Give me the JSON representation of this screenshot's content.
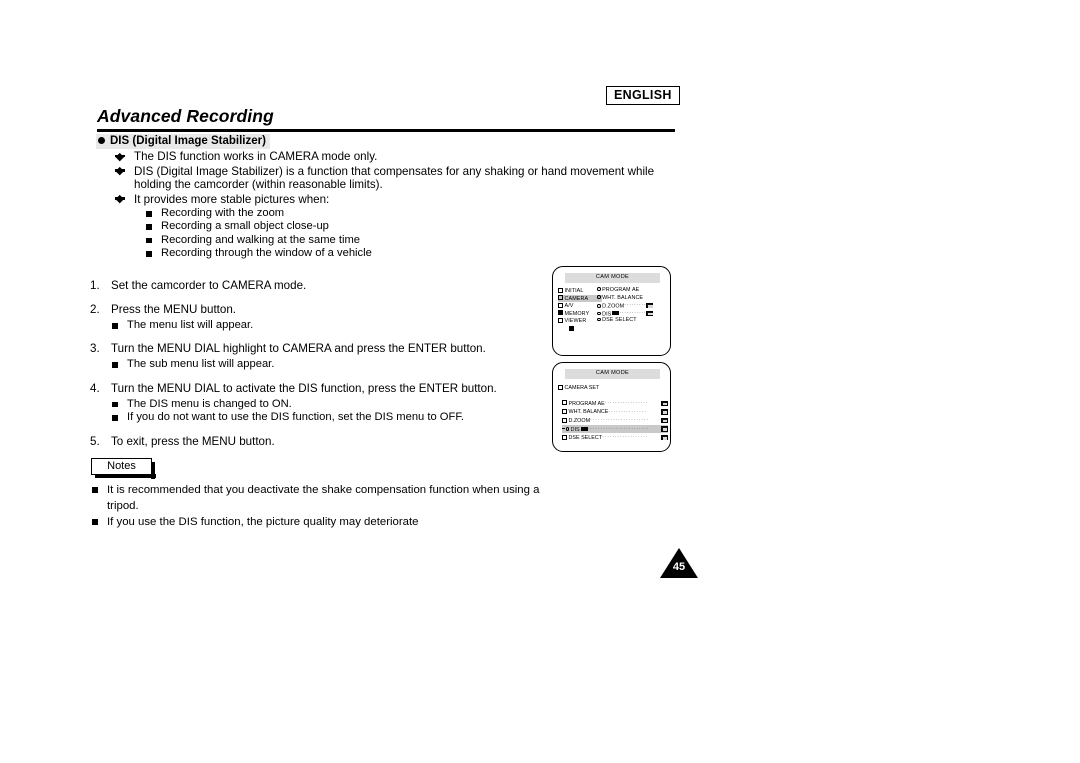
{
  "header": {
    "language_badge": "ENGLISH",
    "chapter_title": "Advanced Recording"
  },
  "section": {
    "heading": "DIS (Digital Image Stabilizer)",
    "bullets": [
      {
        "text": "The DIS function works in CAMERA mode only."
      },
      {
        "text": "DIS (Digital Image Stabilizer) is a function that compensates for any shaking or hand movement while holding the camcorder (within reasonable limits)."
      },
      {
        "text": "It provides more stable pictures when:",
        "sub": [
          "Recording with the zoom",
          "Recording a small object close-up",
          "Recording and walking at the same time",
          "Recording through the window of a vehicle"
        ]
      }
    ]
  },
  "steps": [
    {
      "num": "1.",
      "text": "Set the camcorder to CAMERA mode.",
      "sub": []
    },
    {
      "num": "2.",
      "text": "Press the MENU button.",
      "sub": [
        "The menu list will appear."
      ]
    },
    {
      "num": "3.",
      "text": "Turn the MENU DIAL highlight to CAMERA and press the ENTER button.",
      "sub": [
        "The sub menu list will appear."
      ]
    },
    {
      "num": "4.",
      "text": "Turn the MENU DIAL to activate the DIS function, press the ENTER button.",
      "sub": [
        "The DIS menu is changed to ON.",
        "If you do not want to use the DIS function, set the DIS menu to OFF."
      ]
    },
    {
      "num": "5.",
      "text": "To exit, press the MENU button.",
      "sub": []
    }
  ],
  "notes": {
    "label": "Notes",
    "items": [
      "It is recommended that you deactivate the shake compensation function when using a tripod.",
      "If you use the DIS function, the picture quality may deteriorate"
    ]
  },
  "lcd_screens": [
    {
      "id": "main-menu",
      "title": "CAM MODE",
      "left_column": [
        {
          "label": "INITIAL",
          "icon": "folder-icon",
          "highlighted": false
        },
        {
          "label": "CAMERA",
          "icon": "folder-icon",
          "highlighted": true
        },
        {
          "label": "A/V",
          "icon": "folder-icon",
          "highlighted": false
        },
        {
          "label": "MEMORY",
          "icon": "folder-filled-icon",
          "highlighted": false
        },
        {
          "label": "VIEWER",
          "icon": "folder-icon",
          "highlighted": false
        },
        {
          "label": "",
          "icon": "exit-icon",
          "highlighted": false
        }
      ],
      "right_column": [
        {
          "label": "PROGRAM AE",
          "icon": "bullet-icon",
          "dots": false,
          "badge": false
        },
        {
          "label": "WHT. BALANCE",
          "icon": "bullet-icon",
          "dots": false,
          "badge": false
        },
        {
          "label": "D.ZOOM",
          "icon": "bullet-icon",
          "dots": true,
          "badge": true
        },
        {
          "label": "DIS",
          "icon": "bullet-icon",
          "dots": true,
          "badge": true
        },
        {
          "label": "DSE SELECT",
          "icon": "bullet-icon",
          "dots": false,
          "badge": false
        }
      ]
    },
    {
      "id": "camera-set-submenu",
      "title": "CAM MODE",
      "header_label": "CAMERA SET",
      "rows": [
        {
          "label": "PROGRAM AE",
          "highlighted": false,
          "badge": true
        },
        {
          "label": "WHT. BALANCE",
          "highlighted": false,
          "badge": true
        },
        {
          "label": "D.ZOOM",
          "highlighted": false,
          "badge": true
        },
        {
          "label": "DIS",
          "highlighted": true,
          "badge": true
        },
        {
          "label": "DSE SELECT",
          "highlighted": false,
          "badge": true
        }
      ]
    }
  ],
  "page_number": "45"
}
